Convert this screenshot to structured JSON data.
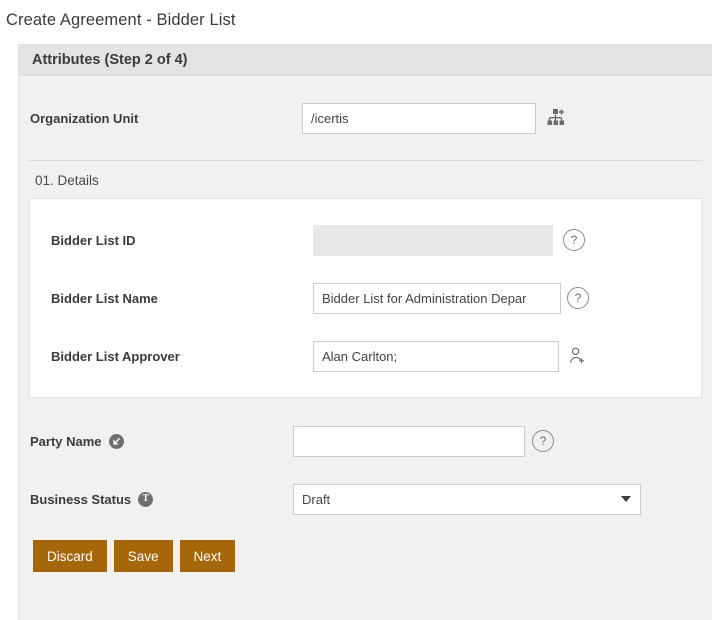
{
  "page": {
    "title": "Create Agreement - Bidder List"
  },
  "card": {
    "header_title": "Attributes (Step 2 of 4)"
  },
  "org_unit": {
    "label": "Organization Unit",
    "value": "/icertis",
    "placeholder": "",
    "icon": "org-chart-add-icon"
  },
  "details": {
    "section_title": "01. Details",
    "fields": [
      {
        "label": "Bidder List ID",
        "value": "",
        "placeholder": "",
        "disabled": true,
        "trailing_icon": "help-icon",
        "help_glyph": "?"
      },
      {
        "label": "Bidder List Name",
        "value": "Bidder List for Administration Depar",
        "placeholder": "",
        "disabled": false,
        "trailing_icon": "help-icon",
        "help_glyph": "?"
      },
      {
        "label": "Bidder List Approver",
        "value": "Alan Carlton;",
        "placeholder": "",
        "disabled": false,
        "trailing_icon": "person-add-icon",
        "help_glyph": ""
      }
    ]
  },
  "lower": {
    "party_name": {
      "label": "Party Name",
      "badge_icon": "arrow-down-left-badge-icon",
      "value": "",
      "placeholder": "",
      "trailing_icon": "help-icon",
      "help_glyph": "?"
    },
    "business_status": {
      "label": "Business Status",
      "badge_icon": "letter-t-badge-icon",
      "badge_letter": "T",
      "value": "Draft",
      "options": [
        "Draft"
      ],
      "caret_icon": "chevron-down-icon"
    }
  },
  "buttons": {
    "discard": "Discard",
    "save": "Save",
    "next": "Next"
  },
  "colors": {
    "button": "#a5670a",
    "card_bg": "#f2f1ef",
    "header_bg": "#e6e4e3",
    "badge": "#6f6f6f"
  }
}
